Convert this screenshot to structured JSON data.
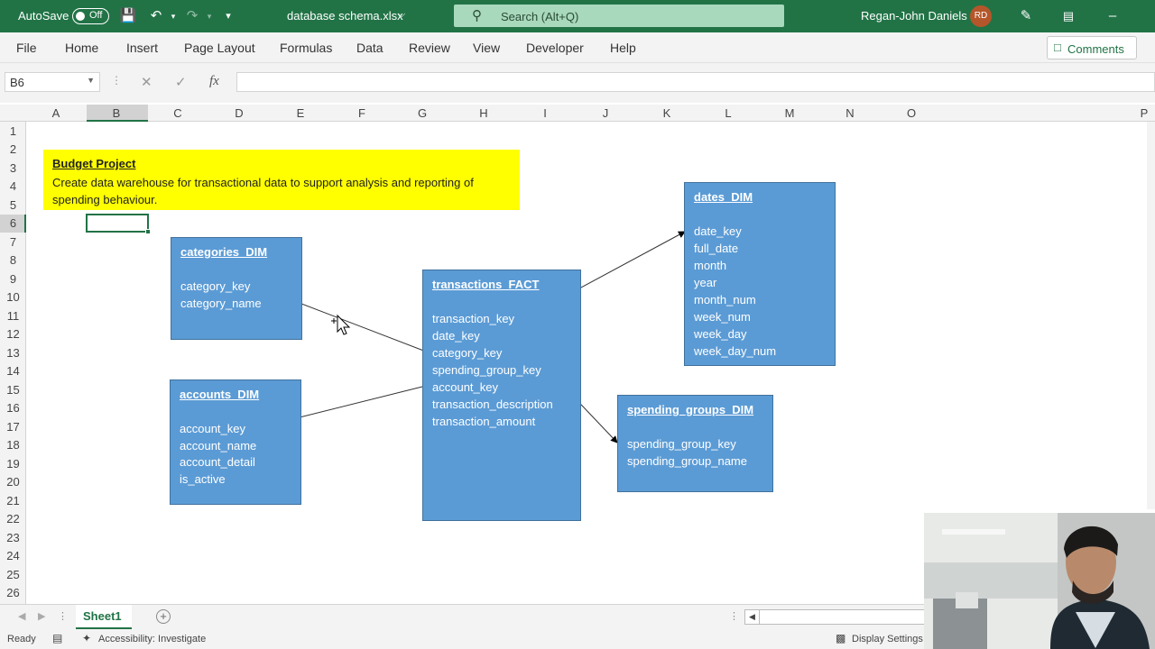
{
  "titlebar": {
    "autosave_label": "AutoSave",
    "autosave_state": "Off",
    "filename": "database schema.xlsx",
    "search_placeholder": "Search (Alt+Q)",
    "user_name": "Regan-John Daniels",
    "user_initials": "RD"
  },
  "menu": {
    "items": [
      "File",
      "Home",
      "Insert",
      "Page Layout",
      "Formulas",
      "Data",
      "Review",
      "View",
      "Developer",
      "Help"
    ],
    "comments_label": "Comments"
  },
  "formula_bar": {
    "name_box": "B6",
    "fx": "fx",
    "value": ""
  },
  "grid": {
    "columns": [
      "A",
      "B",
      "C",
      "D",
      "E",
      "F",
      "G",
      "H",
      "I",
      "J",
      "K",
      "L",
      "M",
      "N",
      "O",
      "P"
    ],
    "rows": [
      "1",
      "2",
      "3",
      "4",
      "5",
      "6",
      "7",
      "8",
      "9",
      "10",
      "11",
      "12",
      "13",
      "14",
      "15",
      "16",
      "17",
      "18",
      "19",
      "20",
      "21",
      "22",
      "23",
      "24",
      "25",
      "26"
    ],
    "selected_cell": "B6"
  },
  "note": {
    "title": "Budget Project",
    "description": "Create data warehouse for transactional data to support analysis and reporting of spending behaviour."
  },
  "tables": {
    "categories": {
      "title": "categories_DIM",
      "fields": [
        "category_key",
        "category_name"
      ]
    },
    "accounts": {
      "title": "accounts_DIM",
      "fields": [
        "account_key",
        "account_name",
        "account_detail",
        "is_active"
      ]
    },
    "transactions": {
      "title": "transactions_FACT",
      "fields": [
        "transaction_key",
        "date_key",
        "category_key",
        "spending_group_key",
        "account_key",
        "transaction_description",
        "transaction_amount"
      ]
    },
    "dates": {
      "title": "dates_DIM",
      "fields": [
        "date_key",
        "full_date",
        "month",
        "year",
        "month_num",
        "week_num",
        "week_day",
        "week_day_num"
      ]
    },
    "spending_groups": {
      "title": "spending_groups_DIM",
      "fields": [
        "spending_group_key",
        "spending_group_name"
      ]
    }
  },
  "sheets": {
    "active": "Sheet1"
  },
  "status": {
    "ready": "Ready",
    "accessibility": "Accessibility: Investigate",
    "display_settings": "Display Settings"
  },
  "colors": {
    "excel_green": "#217346",
    "box_fill": "#5b9bd5",
    "note_fill": "#ffff00"
  }
}
